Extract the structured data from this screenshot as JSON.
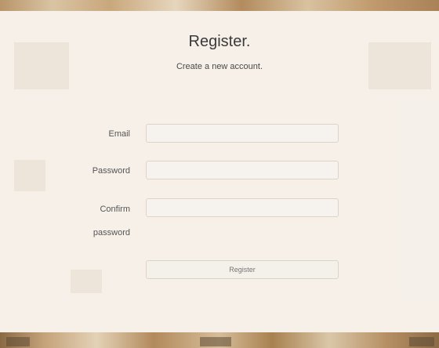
{
  "header": {
    "title": "Register.",
    "subtitle": "Create a new account."
  },
  "form": {
    "email_label": "Email",
    "password_label": "Password",
    "confirm_label_line1": "Confirm",
    "confirm_label_line2": "password",
    "email_value": "",
    "password_value": "",
    "confirm_value": "",
    "submit_label": "Register"
  },
  "colors": {
    "panel": "#f7f3ed",
    "text": "#3a3a3a",
    "wood": "#c9a77c"
  }
}
